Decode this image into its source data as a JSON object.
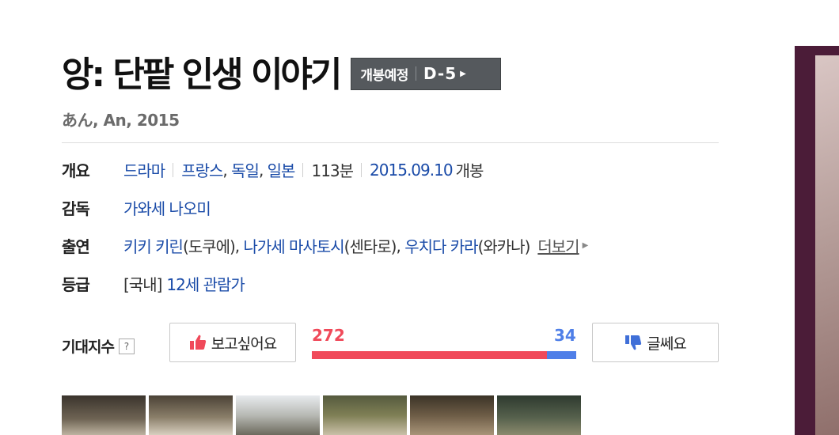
{
  "movie": {
    "title": "앙: 단팥 인생 이야기",
    "subtitle": "あん, An, 2015"
  },
  "release_badge": {
    "label": "개봉예정",
    "dday": "D-5"
  },
  "info": {
    "overview": {
      "label": "개요",
      "genre": "드라마",
      "countries": [
        "프랑스",
        "독일",
        "일본"
      ],
      "runtime": "113분",
      "release_date": "2015.09.10",
      "release_suffix": "개봉"
    },
    "director": {
      "label": "감독",
      "name": "가와세 나오미"
    },
    "cast": {
      "label": "출연",
      "members": [
        {
          "name": "키키 키린",
          "role": "(도쿠에)"
        },
        {
          "name": "나가세 마사토시",
          "role": "(센타로)"
        },
        {
          "name": "우치다 카라",
          "role": "(와카나)"
        }
      ],
      "more_label": "더보기"
    },
    "rating": {
      "label": "등급",
      "region": "[국내]",
      "value": "12세 관람가"
    }
  },
  "expectation": {
    "label": "기대지수",
    "help": "?",
    "like_label": "보고싶어요",
    "dislike_label": "글쎄요",
    "like_count": 272,
    "dislike_count": 34
  },
  "colors": {
    "like": "#f04a5a",
    "dislike": "#4f7fe8",
    "link": "#1a4ba8",
    "badge_bg": "#55595d"
  },
  "icons": {
    "like": "thumbs-up-icon",
    "dislike": "thumbs-down-icon",
    "badge_arrow": "triangle-right-icon",
    "more_arrow": "triangle-right-icon"
  }
}
